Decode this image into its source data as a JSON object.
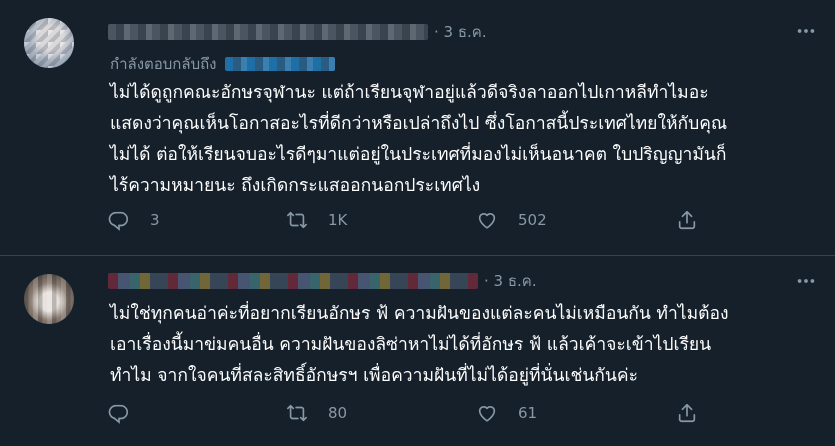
{
  "tweets": [
    {
      "date": "3 ธ.ค.",
      "reply_prefix": "กำลังตอบกลับถึง",
      "lines": [
        "ไม่ได้ดูถูกคณะอักษรจุฬานะ แต่ถ้าเรียนจุฬาอยู่แล้วดีจริงลาออกไปเกาหลีทำไมอะ",
        "แสดงว่าคุณเห็นโอกาสอะไรที่ดีกว่าหรือเปล่าถึงไป ซึ่งโอกาสนี้ประเทศไทยให้กับคุณ",
        "ไม่ได้ ต่อให้เรียนจบอะไรดีๆมาแต่อยู่ในประเทศที่มองไม่เห็นอนาคต ใบปริญญามันก็",
        "ไร้ความหมายนะ ถึงเกิดกระแสออกนอกประเทศไง"
      ],
      "replies": "3",
      "retweets": "1K",
      "likes": "502"
    },
    {
      "date": "3 ธ.ค.",
      "lines": [
        "ไม่ใช่ทุกคนอ่าค่ะที่อยากเรียนอักษร ฟ้ ความฝันของแต่ละคนไม่เหมือนกัน ทำไมต้อง",
        "เอาเรื่องนี้มาข่มคนอื่น ความฝันของลิซ่าหาไม่ได้ที่อักษร ฟ้ แล้วเค้าจะเข้าไปเรียน",
        "ทำไม จากใจคนที่สละสิทธิ์อักษรฯ เพื่อความฝันที่ไม่ได้อยู่ที่นั่นเช่นกันค่ะ"
      ],
      "replies": "",
      "retweets": "80",
      "likes": "61"
    }
  ],
  "icons": {
    "reply": "reply-icon",
    "retweet": "retweet-icon",
    "like": "heart-icon",
    "share": "share-icon",
    "more": "more-icon"
  },
  "colors": {
    "background": "#15202b",
    "text": "#ffffff",
    "secondary": "#8899a6",
    "divider": "#38444d"
  }
}
